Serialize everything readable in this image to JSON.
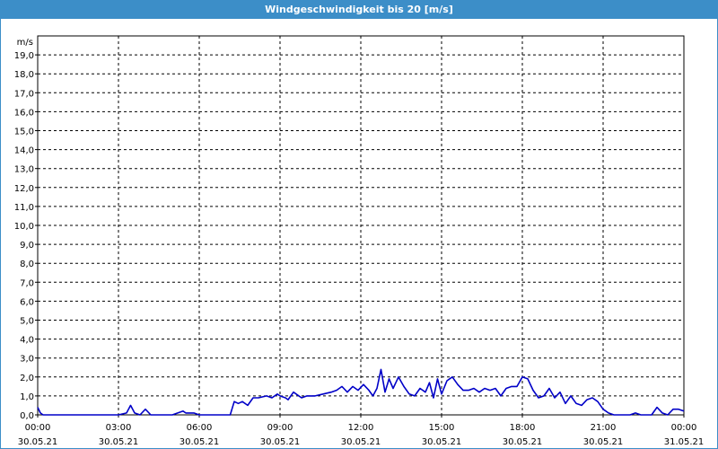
{
  "window": {
    "title": "Windgeschwindigkeit bis 20 [m/s]"
  },
  "colors": {
    "title_bar": "#3c8ec8",
    "series_line": "#0000c8",
    "grid": "#000000"
  },
  "chart_data": {
    "type": "line",
    "title": "Windgeschwindigkeit bis 20 [m/s]",
    "ylabel": "m/s",
    "xlabel": "",
    "ylim": [
      0,
      20
    ],
    "y_ticks": [
      "0,0",
      "1,0",
      "2,0",
      "3,0",
      "4,0",
      "5,0",
      "6,0",
      "7,0",
      "8,0",
      "9,0",
      "10,0",
      "11,0",
      "12,0",
      "13,0",
      "14,0",
      "15,0",
      "16,0",
      "17,0",
      "18,0",
      "19,0"
    ],
    "xlim_hours": [
      0,
      24
    ],
    "x_ticks": [
      {
        "time": "00:00",
        "date": "30.05.21"
      },
      {
        "time": "03:00",
        "date": "30.05.21"
      },
      {
        "time": "06:00",
        "date": "30.05.21"
      },
      {
        "time": "09:00",
        "date": "30.05.21"
      },
      {
        "time": "12:00",
        "date": "30.05.21"
      },
      {
        "time": "15:00",
        "date": "30.05.21"
      },
      {
        "time": "18:00",
        "date": "30.05.21"
      },
      {
        "time": "21:00",
        "date": "30.05.21"
      },
      {
        "time": "00:00",
        "date": "31.05.21"
      }
    ],
    "grid": true,
    "legend": "none",
    "series": [
      {
        "x": [
          0.0,
          0.1,
          0.2,
          0.5,
          1.0,
          1.5,
          2.0,
          2.5,
          3.0,
          3.3,
          3.45,
          3.6,
          3.8,
          4.0,
          4.2,
          4.4,
          4.6,
          5.0,
          5.4,
          5.5,
          5.8,
          6.0,
          6.5,
          7.0,
          7.15,
          7.3,
          7.45,
          7.6,
          7.8,
          8.0,
          8.2,
          8.5,
          8.7,
          8.9,
          9.0,
          9.2,
          9.3,
          9.5,
          9.8,
          10.0,
          10.3,
          10.6,
          10.9,
          11.1,
          11.3,
          11.5,
          11.7,
          11.9,
          12.1,
          12.3,
          12.45,
          12.6,
          12.75,
          12.9,
          13.05,
          13.2,
          13.4,
          13.6,
          13.8,
          14.0,
          14.2,
          14.4,
          14.55,
          14.7,
          14.85,
          15.0,
          15.2,
          15.4,
          15.6,
          15.8,
          16.0,
          16.2,
          16.4,
          16.6,
          16.8,
          17.0,
          17.2,
          17.4,
          17.6,
          17.8,
          18.0,
          18.2,
          18.4,
          18.6,
          18.8,
          19.0,
          19.2,
          19.4,
          19.6,
          19.8,
          20.0,
          20.2,
          20.4,
          20.6,
          20.8,
          21.0,
          21.2,
          21.4,
          21.6,
          21.8,
          22.0,
          22.2,
          22.4,
          22.6,
          22.8,
          23.0,
          23.2,
          23.4,
          23.6,
          23.8,
          24.0
        ],
        "y": [
          0.4,
          0.1,
          0.0,
          0.0,
          0.0,
          0.0,
          0.0,
          0.0,
          0.0,
          0.1,
          0.5,
          0.1,
          0.0,
          0.3,
          0.0,
          0.0,
          0.0,
          0.0,
          0.2,
          0.1,
          0.1,
          0.0,
          0.0,
          0.0,
          0.0,
          0.7,
          0.6,
          0.7,
          0.5,
          0.9,
          0.9,
          1.0,
          0.9,
          1.1,
          1.0,
          0.9,
          0.8,
          1.2,
          0.9,
          1.0,
          1.0,
          1.1,
          1.2,
          1.3,
          1.5,
          1.2,
          1.5,
          1.3,
          1.6,
          1.3,
          1.0,
          1.4,
          2.4,
          1.2,
          1.9,
          1.4,
          2.0,
          1.5,
          1.1,
          1.0,
          1.4,
          1.2,
          1.7,
          0.9,
          1.9,
          1.1,
          1.8,
          2.0,
          1.6,
          1.3,
          1.3,
          1.4,
          1.2,
          1.4,
          1.3,
          1.4,
          1.0,
          1.4,
          1.5,
          1.5,
          2.0,
          1.9,
          1.3,
          0.9,
          1.0,
          1.4,
          0.9,
          1.2,
          0.6,
          1.0,
          0.6,
          0.5,
          0.8,
          0.9,
          0.7,
          0.3,
          0.1,
          0.0,
          0.0,
          0.0,
          0.0,
          0.1,
          0.0,
          0.0,
          0.0,
          0.4,
          0.1,
          0.0,
          0.3,
          0.3,
          0.2
        ]
      }
    ]
  }
}
